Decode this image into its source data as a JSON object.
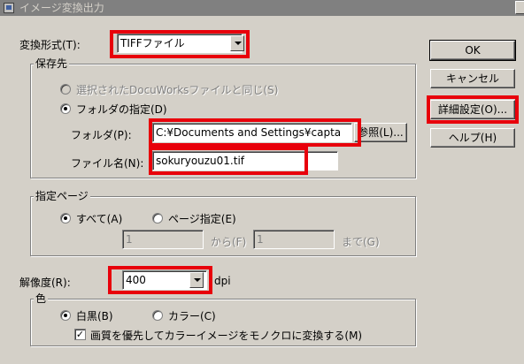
{
  "window": {
    "title": "イメージ変換出力"
  },
  "format": {
    "label": "変換形式(T):",
    "value": "TIFFファイル"
  },
  "buttons": {
    "ok": "OK",
    "cancel": "キャンセル",
    "details": "詳細設定(O)...",
    "help": "ヘルプ(H)"
  },
  "save_dest": {
    "group_label": "保存先",
    "radio_selected_docuworks": "選択されたDocuWorksファイルと同じ(S)",
    "radio_folder": "フォルダの指定(D)",
    "folder_label": "フォルダ(P):",
    "folder_value": "C:¥Documents and Settings¥capta",
    "browse_label": "参照(L)...",
    "filename_label": "ファイル名(N):",
    "filename_value": "sokuryouzu01.tif"
  },
  "pages": {
    "group_label": "指定ページ",
    "radio_all": "すべて(A)",
    "radio_range": "ページ指定(E)",
    "from_value": "1",
    "from_label": "から(F)",
    "to_value": "1",
    "to_label": "まで(G)"
  },
  "resolution": {
    "label": "解像度(R):",
    "value": "400",
    "unit": "dpi"
  },
  "color": {
    "group_label": "色",
    "radio_bw": "白黒(B)",
    "radio_color": "カラー(C)",
    "checkbox_label": "画質を優先してカラーイメージをモノクロに変換する(M)",
    "checkbox_checked": true
  },
  "highlight_color": "#e8000b"
}
